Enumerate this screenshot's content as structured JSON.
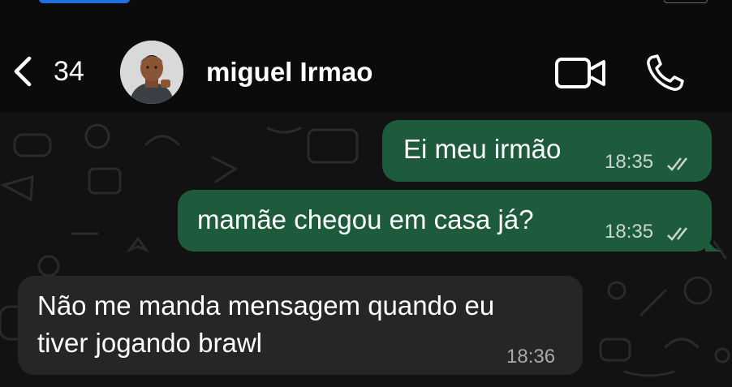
{
  "header": {
    "back_count": "34",
    "contact_name": "miguel Irmao"
  },
  "messages": [
    {
      "direction": "outgoing",
      "text": "Ei meu irmão",
      "time": "18:35",
      "status": "read"
    },
    {
      "direction": "outgoing",
      "text": "mamãe chegou em casa já?",
      "time": "18:35",
      "status": "read"
    },
    {
      "direction": "incoming",
      "lines": [
        "Não me manda mensagem quando eu",
        "tiver jogando brawl"
      ],
      "time": "18:36"
    }
  ],
  "colors": {
    "outgoing_bubble": "#1d5b3c",
    "incoming_bubble": "#262626",
    "background": "#121212",
    "header": "#0b0b0b"
  },
  "icons": [
    "back-chevron-icon",
    "video-camera-icon",
    "phone-icon",
    "double-check-icon"
  ]
}
